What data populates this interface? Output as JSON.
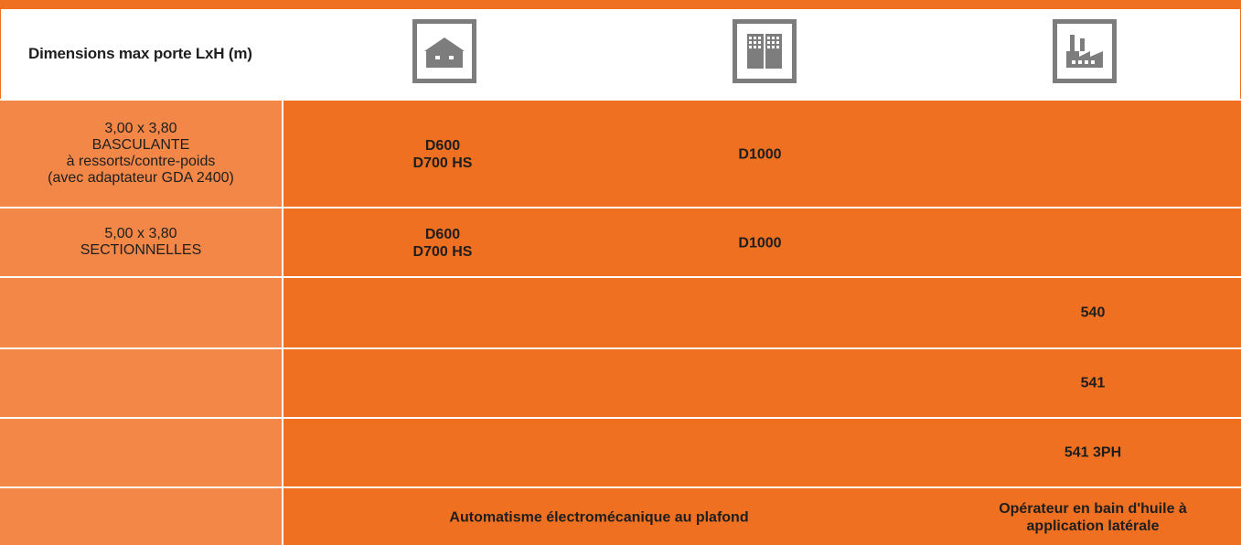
{
  "header": {
    "label": "Dimensions max porte LxH (m)",
    "icons": [
      "house-icon",
      "apartment-building-icon",
      "factory-icon"
    ]
  },
  "rows": [
    {
      "left": [
        "3,00 x 3,80",
        "BASCULANTE",
        "à ressorts/contre-poids",
        "(avec adaptateur GDA 2400)"
      ],
      "col1": [
        "D600",
        "D700 HS"
      ],
      "col2": "D1000",
      "col3": ""
    },
    {
      "left": [
        "5,00 x 3,80",
        "SECTIONNELLES"
      ],
      "col1": [
        "D600",
        "D700 HS"
      ],
      "col2": "D1000",
      "col3": ""
    },
    {
      "left": [],
      "col3": "540"
    },
    {
      "left": [],
      "col3": "541"
    },
    {
      "left": [],
      "col3": "541 3PH"
    },
    {
      "left": [],
      "span": "Automatisme électromécanique au plafond",
      "col3": [
        "Opérateur en bain d'huile à",
        "application latérale"
      ]
    }
  ],
  "colors": {
    "orange": "#f07021",
    "orange_light": "#f38748",
    "icon_gray": "#7d7d7d",
    "text": "#1e1e1e"
  }
}
